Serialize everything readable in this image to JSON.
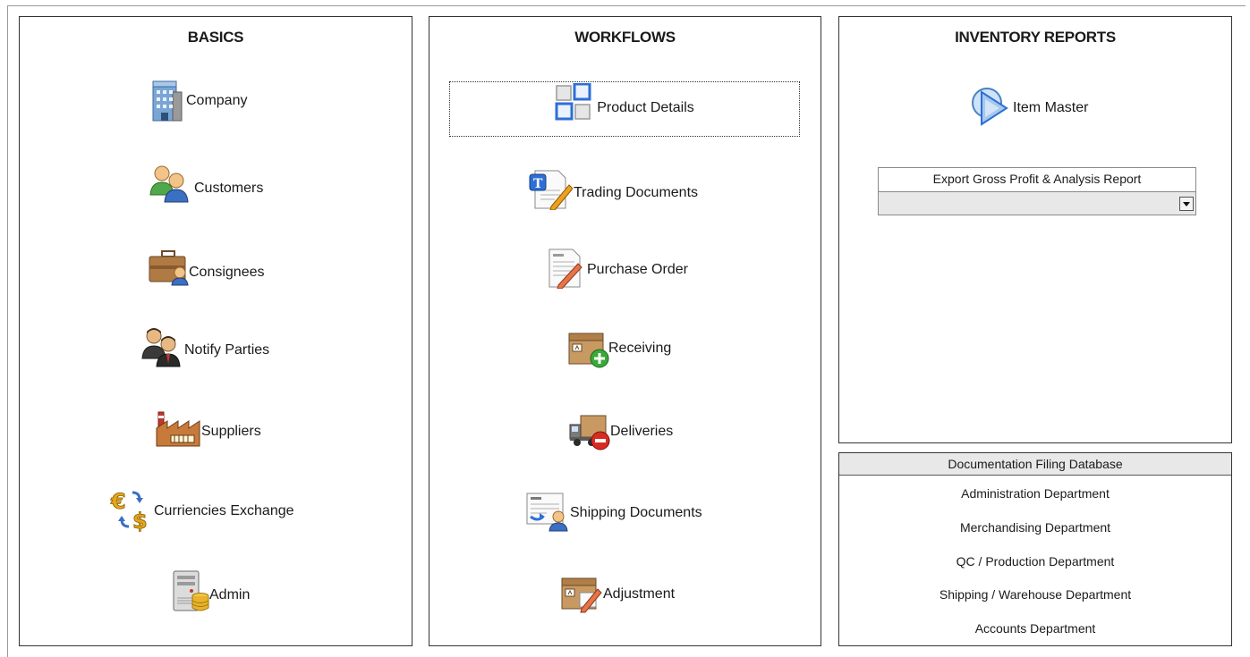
{
  "basics": {
    "title": "BASICS",
    "items": [
      {
        "label": "Company",
        "icon": "building-icon"
      },
      {
        "label": "Customers",
        "icon": "users-icon"
      },
      {
        "label": "Consignees",
        "icon": "briefcase-user-icon"
      },
      {
        "label": "Notify Parties",
        "icon": "businessmen-icon"
      },
      {
        "label": "Suppliers",
        "icon": "factory-icon"
      },
      {
        "label": "Curriencies Exchange",
        "icon": "currency-exchange-icon"
      },
      {
        "label": "Admin",
        "icon": "server-database-icon"
      }
    ]
  },
  "workflows": {
    "title": "WORKFLOWS",
    "items": [
      {
        "label": "Product Details",
        "icon": "grid-squares-icon",
        "focused": true
      },
      {
        "label": "Trading Documents",
        "icon": "text-document-pencil-icon"
      },
      {
        "label": "Purchase Order",
        "icon": "document-pencil-icon"
      },
      {
        "label": "Receiving",
        "icon": "box-add-icon"
      },
      {
        "label": "Deliveries",
        "icon": "truck-remove-icon"
      },
      {
        "label": "Shipping Documents",
        "icon": "document-user-icon"
      },
      {
        "label": "Adjustment",
        "icon": "box-pencil-icon"
      }
    ]
  },
  "reports": {
    "title": "INVENTORY REPORTS",
    "item_master": {
      "label": "Item Master",
      "icon": "play-shapes-icon"
    },
    "export": {
      "label": "Export Gross Profit & Analysis Report",
      "selected_value": ""
    }
  },
  "docs": {
    "title": "Documentation Filing Database",
    "links": [
      "Administration Department",
      "Merchandising Department",
      "QC / Production Department",
      "Shipping / Warehouse Department",
      "Accounts Department"
    ]
  }
}
